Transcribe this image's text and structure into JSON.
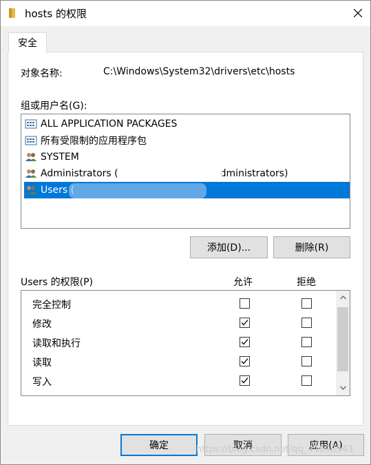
{
  "window": {
    "title": "hosts 的权限",
    "close_icon": "close-icon"
  },
  "tab": {
    "label": "安全"
  },
  "object": {
    "label": "对象名称:",
    "value": "C:\\Windows\\System32\\drivers\\etc\\hosts"
  },
  "groups": {
    "label": "组或用户名(G):",
    "items": [
      {
        "label": "ALL APPLICATION PACKAGES",
        "icon": "package-icon",
        "selected": false
      },
      {
        "label": "所有受限制的应用程序包",
        "icon": "package-icon",
        "selected": false
      },
      {
        "label": "SYSTEM",
        "icon": "users-icon",
        "selected": false
      },
      {
        "label": "Administrators (",
        "suffix": "dministrators)",
        "icon": "users-icon",
        "selected": false
      },
      {
        "label": "Users (",
        "icon": "users-icon",
        "selected": true
      }
    ]
  },
  "buttons": {
    "add": "添加(D)...",
    "remove": "删除(R)",
    "ok": "确定",
    "cancel": "取消",
    "apply": "应用(A)"
  },
  "permissions": {
    "label": "Users 的权限(P)",
    "allow_header": "允许",
    "deny_header": "拒绝",
    "rows": [
      {
        "name": "完全控制",
        "allow": false,
        "deny": false
      },
      {
        "name": "修改",
        "allow": true,
        "deny": false
      },
      {
        "name": "读取和执行",
        "allow": true,
        "deny": false
      },
      {
        "name": "读取",
        "allow": true,
        "deny": false
      },
      {
        "name": "写入",
        "allow": true,
        "deny": false
      }
    ]
  },
  "watermark": "https://blog.csdn.net/qq_41693543",
  "colors": {
    "selection": "#0078d7",
    "default_button_border": "#0078d7"
  }
}
